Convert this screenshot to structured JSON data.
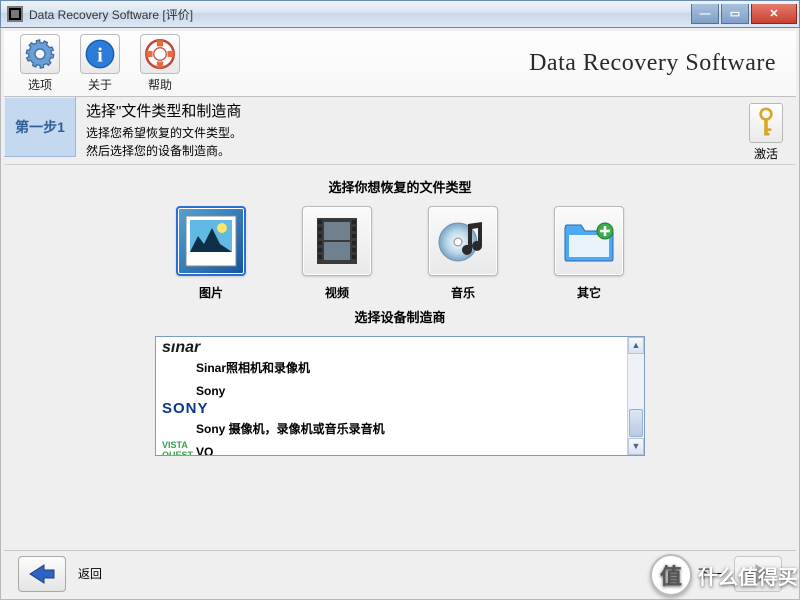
{
  "titlebar": {
    "title": "Data Recovery Software [评价]"
  },
  "app_title": "Data Recovery Software",
  "toolbar": {
    "options": "选项",
    "about": "关于",
    "help": "帮助"
  },
  "step": {
    "label": "第一步1",
    "title": "选择\"文件类型和制造商",
    "line1": "选择您希望恢复的文件类型。",
    "line2": "然后选择您的设备制造商。"
  },
  "activate": {
    "label": "激活"
  },
  "section": {
    "filetypes_title": "选择你想恢复的文件类型",
    "manufacturer_title": "选择设备制造商"
  },
  "filetypes": [
    {
      "id": "photos",
      "label": "图片",
      "selected": true
    },
    {
      "id": "video",
      "label": "视频",
      "selected": false
    },
    {
      "id": "music",
      "label": "音乐",
      "selected": false
    },
    {
      "id": "other",
      "label": "其它",
      "selected": false
    }
  ],
  "manufacturers": [
    {
      "logo": "sinar",
      "logo_text": "sınar",
      "desc": "Sinar照相机和录像机"
    },
    {
      "logo": "",
      "logo_text": "",
      "desc": "Sony"
    },
    {
      "logo": "sony",
      "logo_text": "SONY",
      "desc": "Sony 摄像机，录像机或音乐录音机"
    },
    {
      "logo": "vq",
      "logo_text": "VISTA QUEST",
      "desc": "VQ"
    }
  ],
  "nav": {
    "back": "返回",
    "next": "下一"
  },
  "watermark": {
    "badge": "值",
    "text": "什么值得买"
  }
}
